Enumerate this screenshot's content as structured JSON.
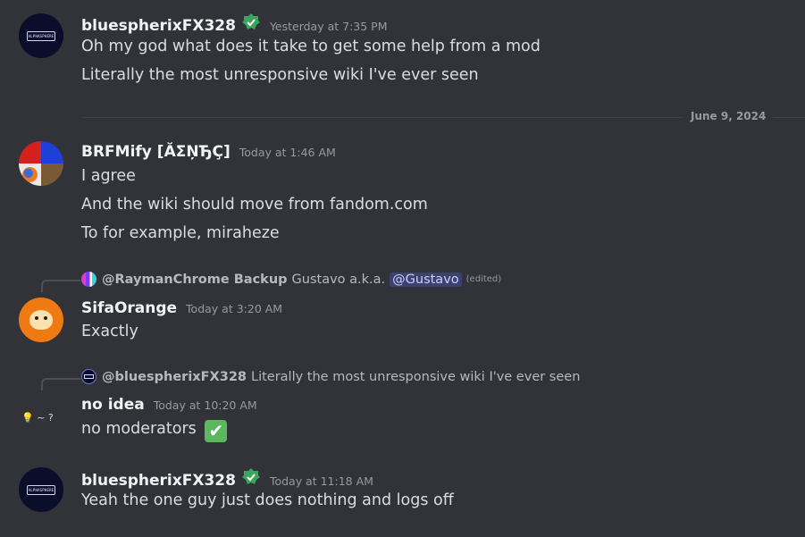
{
  "messages": [
    {
      "username": "bluespherixFX328",
      "timestamp": "Yesterday at 7:35 PM",
      "lines": [
        "Oh my god what does it take to get some help from a mod",
        "Literally the most unresponsive wiki I've ever seen"
      ],
      "avatar_logo": "ALPHASPHERE"
    },
    {
      "username": "BRFMify [ĂΣŅЂÇ]",
      "timestamp": "Today at 1:46 AM",
      "lines": [
        "I agree",
        "And the wiki should move from fandom.com",
        "To for example, miraheze"
      ]
    },
    {
      "reply_user": "@RaymanChrome Backup",
      "reply_text": "Gustavo a.k.a.",
      "reply_mention": "@Gustavo",
      "reply_edited": "(edited)",
      "username": "SifaOrange",
      "timestamp": "Today at 3:20 AM",
      "lines": [
        "Exactly"
      ]
    },
    {
      "reply_user": "@bluespherixFX328",
      "reply_text": "Literally the most unresponsive wiki I've ever seen",
      "username": "no idea",
      "timestamp": "Today at 10:20 AM",
      "lines": [
        "no moderators"
      ],
      "avatar_text": "💡 ~ ?",
      "emoji": "✔"
    },
    {
      "username": "bluespherixFX328",
      "timestamp": "Today at 11:18 AM",
      "lines": [
        "Yeah the one guy just does nothing and logs off"
      ],
      "avatar_logo": "ALPHASPHERE"
    }
  ],
  "divider": "June 9, 2024",
  "colors": {
    "background": "#313338",
    "text": "#dbdee1",
    "muted": "#949ba4",
    "mention_bg": "#3c4270",
    "badge": "#3ba55c"
  }
}
